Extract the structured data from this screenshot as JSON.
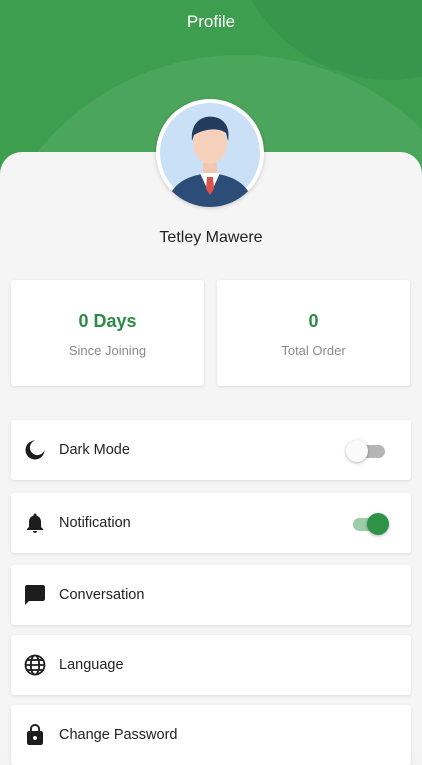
{
  "header": {
    "title": "Profile"
  },
  "user": {
    "name": "Tetley Mawere"
  },
  "stats": [
    {
      "value": "0 Days",
      "label": "Since Joining"
    },
    {
      "value": "0",
      "label": "Total Order"
    }
  ],
  "settings": [
    {
      "label": "Dark Mode",
      "icon": "moon-icon",
      "toggle": false
    },
    {
      "label": "Notification",
      "icon": "bell-icon",
      "toggle": true
    },
    {
      "label": "Conversation",
      "icon": "chat-icon"
    },
    {
      "label": "Language",
      "icon": "globe-icon"
    },
    {
      "label": "Change Password",
      "icon": "lock-icon"
    }
  ],
  "colors": {
    "primary": "#3d9e50",
    "accent": "#2e8b47"
  }
}
